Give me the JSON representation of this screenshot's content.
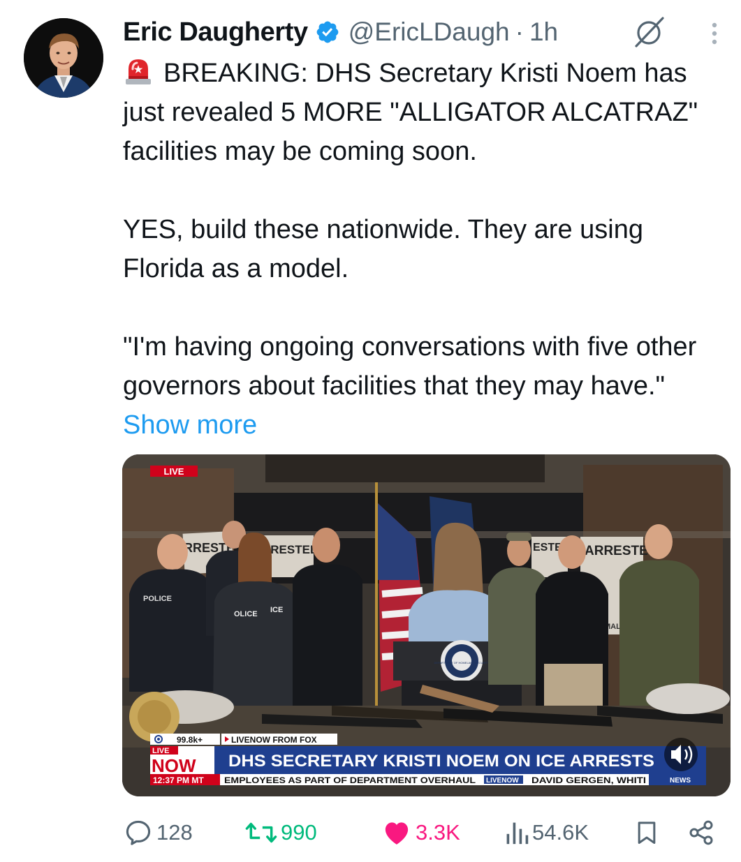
{
  "tweet": {
    "author_name": "Eric Daugherty",
    "handle": "@EricLDaugh",
    "separator": "·",
    "time": "1h",
    "lines": [
      "BREAKING: DHS Secretary Kristi Noem has just revealed 5 MORE \"ALLIGATOR ALCATRAZ\" facilities may be coming soon.",
      "YES, build these nationwide. They are using Florida as a model.",
      "\"I'm having ongoing conversations with five other governors about facilities that they may have.\""
    ],
    "show_more": "Show more",
    "icons": {
      "verified": "verified-badge-icon",
      "grok": "grok-icon",
      "more": "more-options-icon",
      "siren": "police-siren-emoji"
    }
  },
  "media": {
    "live_badge": "LIVE",
    "viewers": "99.8k+",
    "source_label": "LIVENOW FROM FOX",
    "live_small": "LIVE",
    "now_label": "NOW",
    "time_label": "12:37 PM MT",
    "headline": "DHS SECRETARY KRISTI NOEM ON ICE ARRESTS",
    "ticker": "EMPLOYEES AS PART OF DEPARTMENT OVERHAUL",
    "ticker_logo": "LIVENOW",
    "ticker_next": "DAVID GERGEN, WHITI",
    "news_tag": "NEWS",
    "banner_left": "RRESTE",
    "banner_mid": "RRESTED",
    "banner_right1": "ESTE",
    "banner_right2": "ARRESTED",
    "vest_police": "POLICE",
    "vest_police2": "OLICE",
    "vest_ice": "ICE",
    "seal_text": "DEPARTMENT OF HOMELAND SECURITY",
    "sign_partial": "MAL ABU",
    "colors": {
      "lower_third_blue": "#1f3f8f",
      "live_red": "#d0021b",
      "ticker_white": "#ffffff"
    }
  },
  "actions": {
    "replies": "128",
    "retweets": "990",
    "likes": "3.3K",
    "views": "54.6K",
    "colors": {
      "retweet": "#00ba7c",
      "like": "#f91880",
      "muted": "#536471",
      "link": "#1d9bf0"
    }
  }
}
